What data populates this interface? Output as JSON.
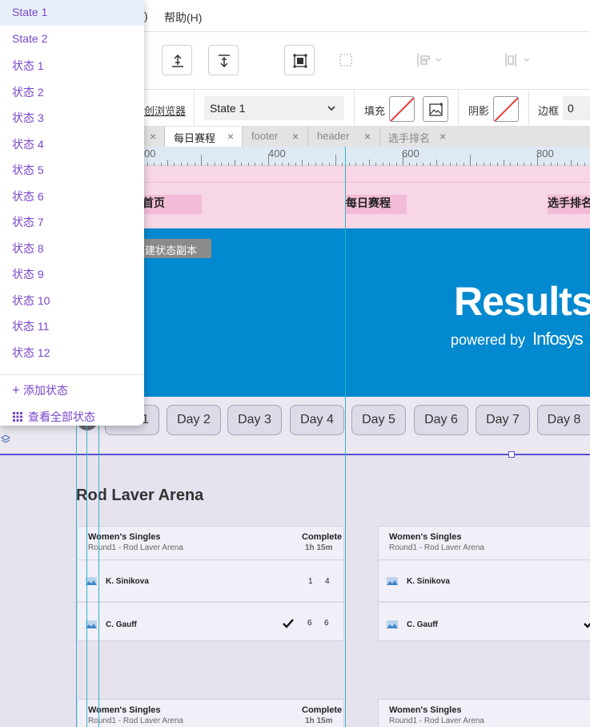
{
  "menubar": {
    "paren_tail": ")",
    "help_label": "帮助(H)"
  },
  "props": {
    "preview_label": "创浏览器",
    "state_select": "State 1",
    "fill_label": "填充",
    "shadow_label": "阴影",
    "border_label": "边框",
    "border_value": "0"
  },
  "tabs": [
    {
      "label": "每日赛程"
    },
    {
      "label": "footer"
    },
    {
      "label": "header"
    },
    {
      "label": "选手排名"
    }
  ],
  "ruler": {
    "n400": "400",
    "n600": "600",
    "n800": "800",
    "n200_tail": "00"
  },
  "nav": {
    "home": "首页",
    "daily": "每日赛程",
    "ranking": "选手排名"
  },
  "banner": {
    "title": "Results",
    "powered": "powered by",
    "brand": "Infosys"
  },
  "days": [
    "Day 1",
    "Day 2",
    "Day 3",
    "Day 4",
    "Day 5",
    "Day 6",
    "Day 7",
    "Day 8"
  ],
  "day1_visible": "1",
  "tooltip": "创建状态副本",
  "arena": "Rod Laver Arena",
  "matches": [
    {
      "title": "Women's Singles",
      "sub": "Round1 - Rod Laver Arena",
      "status": "Complete",
      "duration": "1h 15m",
      "p1": "K. Sinikova",
      "p1s": [
        "1",
        "4"
      ],
      "p2": "C. Gauff",
      "p2s": [
        "6",
        "6"
      ]
    },
    {
      "title": "Women's Singles",
      "sub": "Round1 - Rod Laver Arena",
      "status": "",
      "duration": "",
      "p1": "K. Sinikova",
      "p1s": [],
      "p2": "C. Gauff",
      "p2s": []
    }
  ],
  "matches_row2": [
    {
      "title": "Women's Singles",
      "sub": "Round1 - Rod Laver Arena",
      "status": "Complete",
      "duration": "1h 15m"
    },
    {
      "title": "Women's Singles",
      "sub": "Round1 - Rod Laver Arena"
    }
  ],
  "states": [
    "State 1",
    "State 2",
    "状态 1",
    "状态 2",
    "状态 3",
    "状态 4",
    "状态 5",
    "状态 6",
    "状态 7",
    "状态 8",
    "状态 9",
    "状态 10",
    "状态 11",
    "状态 12"
  ],
  "add_state": "添加状态",
  "view_all": "查看全部状态",
  "colors": {
    "accent": "#7a45c8",
    "banner": "#0389cf",
    "nav": "#f7d6e6",
    "guide": "#33b5c9"
  }
}
